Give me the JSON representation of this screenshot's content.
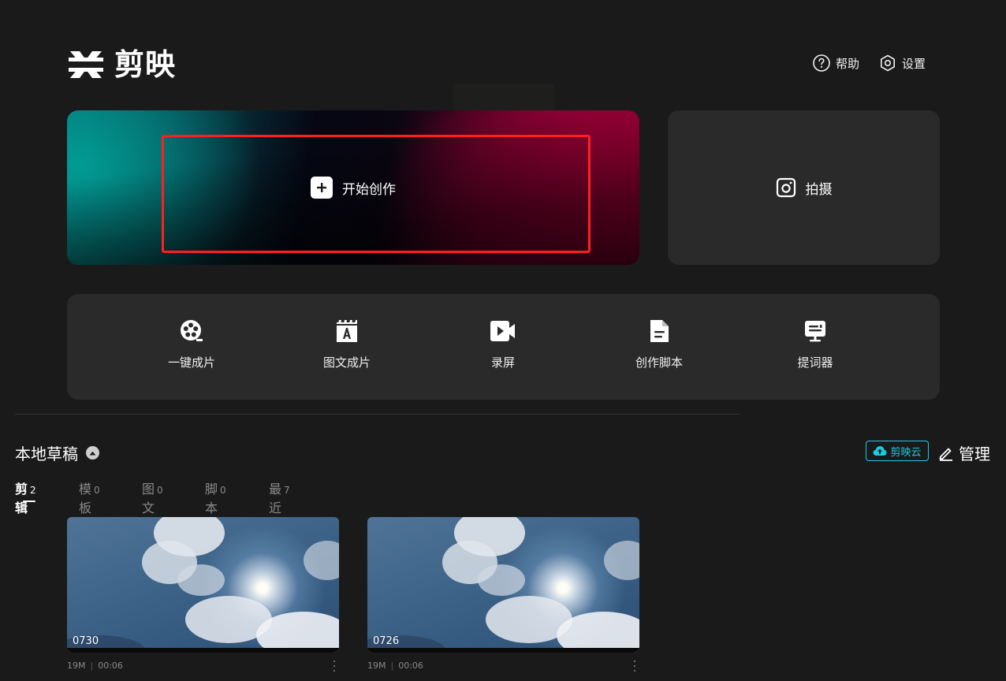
{
  "app": {
    "name": "剪映"
  },
  "header": {
    "help_label": "帮助",
    "settings_label": "设置"
  },
  "hero": {
    "start_label": "开始创作",
    "shoot_label": "拍摄"
  },
  "tools": [
    {
      "label": "一键成片",
      "icon": "film-reel-icon"
    },
    {
      "label": "图文成片",
      "icon": "text-clapper-icon"
    },
    {
      "label": "录屏",
      "icon": "screen-record-icon"
    },
    {
      "label": "创作脚本",
      "icon": "script-doc-icon"
    },
    {
      "label": "提词器",
      "icon": "teleprompter-icon"
    }
  ],
  "drafts": {
    "title": "本地草稿",
    "cloud_label": "剪映云",
    "manage_label": "管理",
    "tabs": [
      {
        "label": "剪辑",
        "count": "2",
        "active": true
      },
      {
        "label": "模板",
        "count": "0",
        "active": false
      },
      {
        "label": "图文",
        "count": "0",
        "active": false
      },
      {
        "label": "脚本",
        "count": "0",
        "active": false
      },
      {
        "label": "最近删除",
        "count": "7",
        "active": false
      }
    ],
    "items": [
      {
        "name": "0730",
        "size": "19M",
        "duration": "00:06"
      },
      {
        "name": "0726",
        "size": "19M",
        "duration": "00:06"
      }
    ]
  },
  "colors": {
    "background": "#1a1a1a",
    "card": "#2a2a2a",
    "accent_cyan": "#1fc8e0",
    "highlight_red": "#ff1f1f"
  }
}
